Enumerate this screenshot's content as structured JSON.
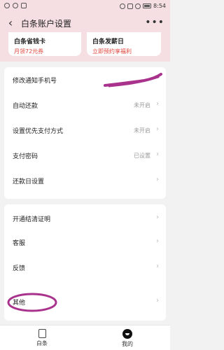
{
  "status_bar": {
    "left_icons": [
      "baidu-icon",
      "wechat-icon",
      "image-icon"
    ],
    "right_icons": [
      "alarm-icon",
      "mute-icon",
      "wifi-icon",
      "battery-icon"
    ],
    "time": "8:54"
  },
  "nav": {
    "title": "白条账户设置",
    "back_icon": "back-chevron-icon",
    "more_icon": "more-dots-icon"
  },
  "promos": [
    {
      "title": "白条省钱卡",
      "subtitle": "月领72元券"
    },
    {
      "title": "白条发薪日",
      "subtitle": "立即预约享福利"
    }
  ],
  "settings": {
    "group1": [
      {
        "label": "修改通知手机号",
        "value": ""
      },
      {
        "label": "自动还款",
        "value": "未开启"
      },
      {
        "label": "设置优先支付方式",
        "value": "未开启"
      },
      {
        "label": "支付密码",
        "value": "已设置"
      },
      {
        "label": "还款日设置",
        "value": ""
      }
    ],
    "group2": [
      {
        "label": "开通结清证明"
      },
      {
        "label": "客服"
      },
      {
        "label": "反馈"
      }
    ],
    "group3": [
      {
        "label": "其他"
      }
    ]
  },
  "annotation_colors": {
    "scribble": "#a8328c",
    "oval": "#a8328c"
  },
  "tab_bar": {
    "tabs": [
      {
        "label": "白条",
        "icon": "page-icon"
      },
      {
        "label": "我的",
        "icon": "user-icon"
      }
    ]
  },
  "colors": {
    "header_bg": "#f6dfe2",
    "accent_red": "#e0463d"
  }
}
